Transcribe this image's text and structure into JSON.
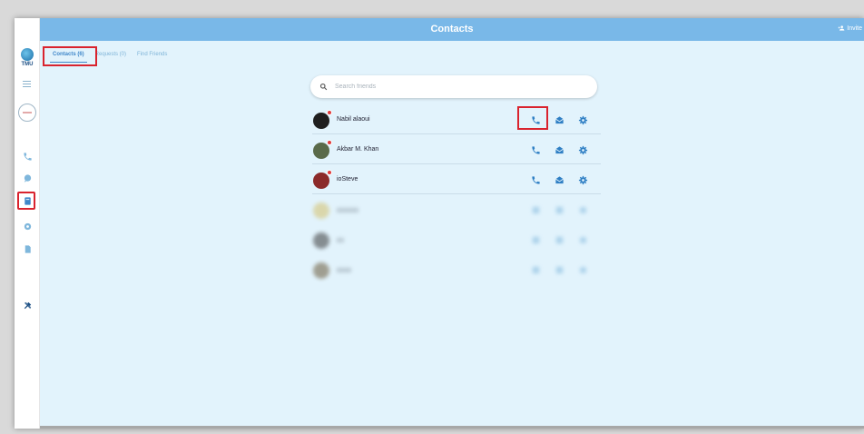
{
  "header": {
    "title": "Contacts",
    "invite_label": "Invite"
  },
  "logo": {
    "text": "TMU"
  },
  "tabs": [
    {
      "label": "Contacts (6)",
      "active": true
    },
    {
      "label": "Requests (0)",
      "active": false
    },
    {
      "label": "Find Friends",
      "active": false
    }
  ],
  "search": {
    "placeholder": "Search friends",
    "value": ""
  },
  "contacts": [
    {
      "name": "Nabil alaoui",
      "avatar_color": "#1f1f1f",
      "visible": true
    },
    {
      "name": "Akbar M. Khan",
      "avatar_color": "#5a6a4a",
      "visible": true
    },
    {
      "name": "ioSteve",
      "avatar_color": "#8b2a2a",
      "visible": true
    },
    {
      "name": "",
      "avatar_color": "#d4c06a",
      "visible": false
    },
    {
      "name": "",
      "avatar_color": "#3a3a3a",
      "visible": false
    },
    {
      "name": "",
      "avatar_color": "#6a5a3a",
      "visible": false
    }
  ],
  "colors": {
    "accent": "#3f87c9",
    "topbar": "#79b8e8",
    "background": "#e2f3fc",
    "highlight": "#d9232e"
  }
}
